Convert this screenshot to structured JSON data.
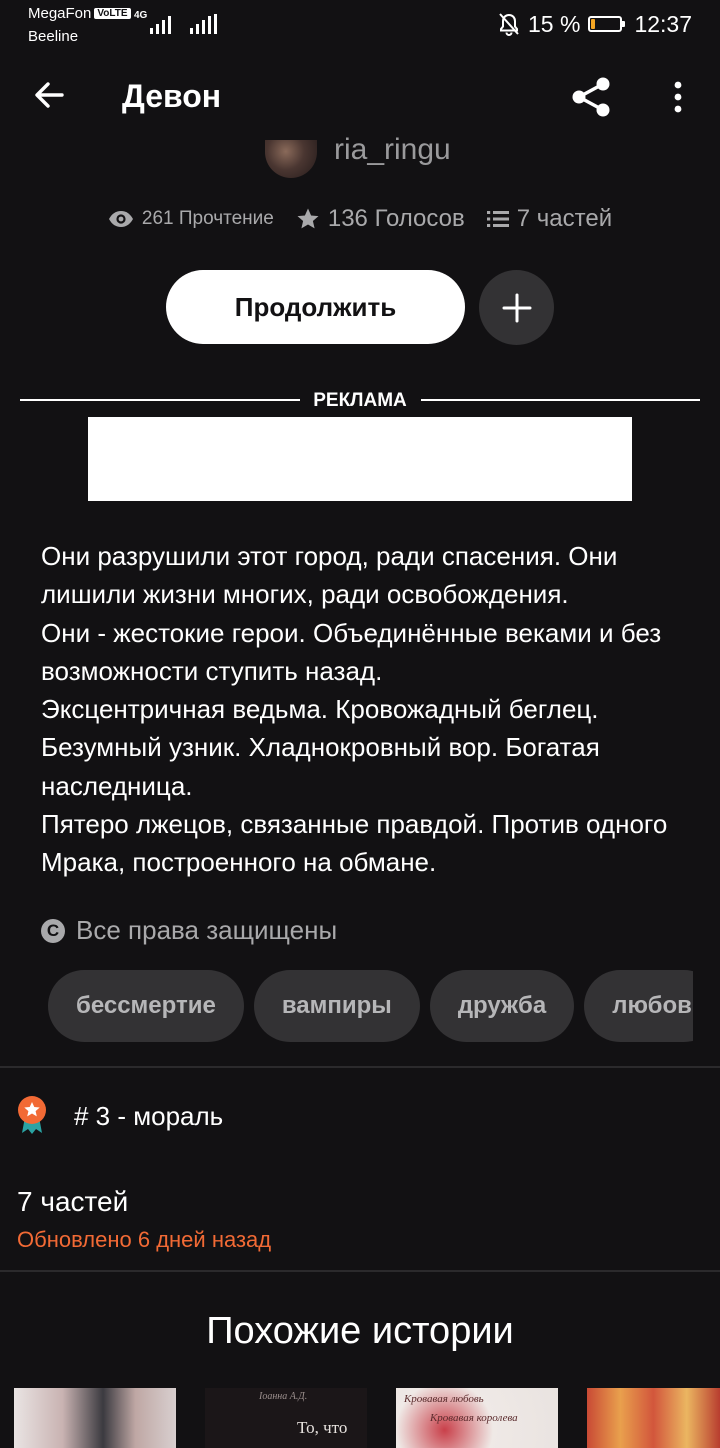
{
  "status_bar": {
    "carrier_primary": "MegaFon",
    "volte_badge": "VoLTE",
    "carrier_secondary": "Beeline",
    "network_type": "4G",
    "battery_percent": "15 %",
    "battery_level": 0.15,
    "battery_color": "#f5a623",
    "time": "12:37",
    "icons": [
      "dnd-off-icon",
      "signal-icon",
      "battery-icon"
    ]
  },
  "header": {
    "title": "Девон",
    "back_icon": "arrow-left-icon",
    "share_icon": "share-icon",
    "more_icon": "more-vertical-icon"
  },
  "author": {
    "name": "ria_ringu"
  },
  "stats": {
    "reads": "261 Прочтение",
    "votes": "136 Голосов",
    "parts": "7 частей"
  },
  "actions": {
    "continue_label": "Продолжить",
    "add_icon": "plus-icon"
  },
  "ad": {
    "label": "РЕКЛАМА"
  },
  "description": [
    "Они разрушили этот город, ради спасения. Они лишили жизни многих, ради освобождения.",
    "Они - жестокие герои. Объединённые веками и без возможности ступить назад.",
    "Эксцентричная ведьма. Кровожадный беглец. Безумный узник. Хладнокровный вор. Богатая наследница.",
    "Пятеро лжецов, связанные правдой. Против одного Мрака, построенного на обмане."
  ],
  "copyright": {
    "icon": "copyright-icon",
    "text": "Все права защищены"
  },
  "tags": [
    "бессмертие",
    "вампиры",
    "дружба",
    "любов"
  ],
  "rank": {
    "icon": "ribbon-badge-icon",
    "text": "# 3 - мораль"
  },
  "parts_section": {
    "count": "7 частей",
    "updated": "Обновлено 6 дней назад",
    "updated_color": "#f26a35"
  },
  "similar": {
    "title": "Похожие истории",
    "covers": [
      {
        "text_top": "",
        "text_bottom": ""
      },
      {
        "text_top": "Іоанна А.Д.",
        "text_bottom": "То, что"
      },
      {
        "text_top": "Кровавая любовь",
        "text_bottom": "Кровавая королева"
      },
      {
        "text_top": "",
        "text_bottom": ""
      }
    ]
  }
}
